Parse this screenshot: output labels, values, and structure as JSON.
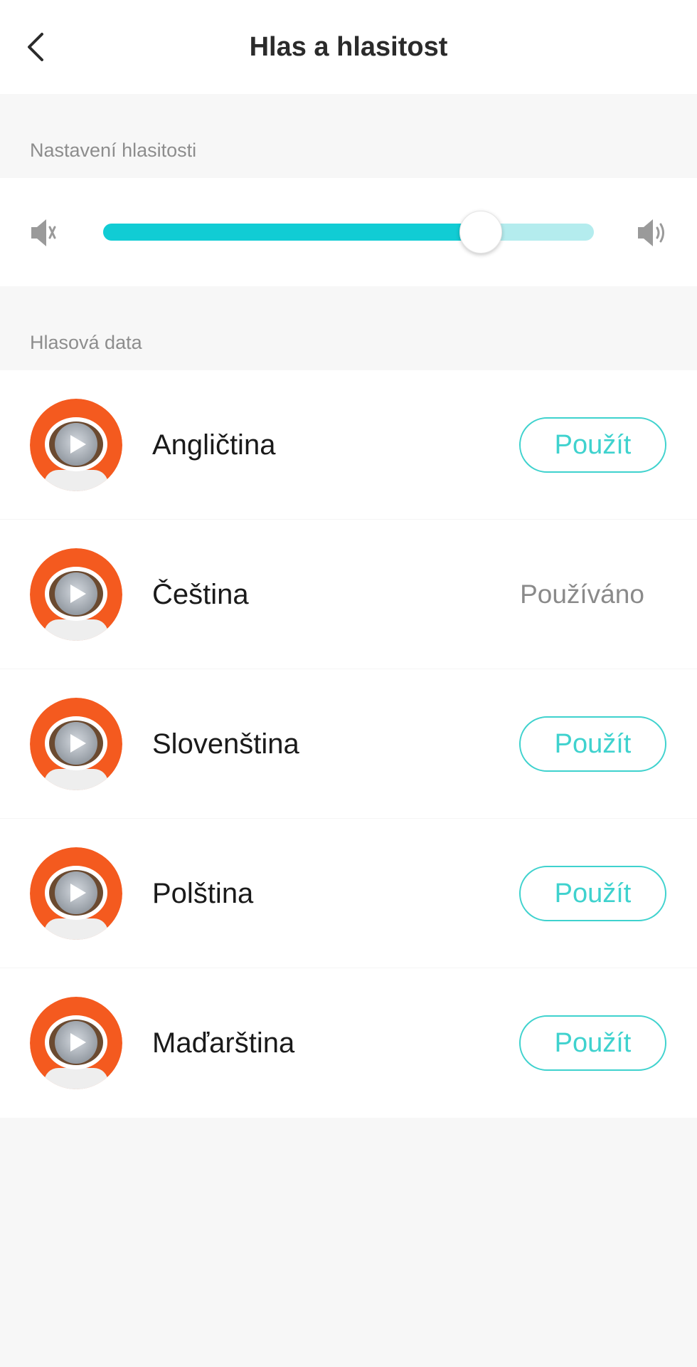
{
  "header": {
    "title": "Hlas a hlasitost",
    "back_icon": "chevron-left-icon"
  },
  "volume": {
    "section_label": "Nastavení hlasitosti",
    "mute_icon": "speaker-mute-icon",
    "loud_icon": "speaker-loud-icon",
    "level": 0.77,
    "colors": {
      "fill": "#11ccd4",
      "track": "#b4ecee"
    }
  },
  "voices": {
    "section_label": "Hlasová data",
    "play_icon": "play-icon",
    "items": [
      {
        "name": "Angličtina",
        "action": "Použít",
        "in_use": false
      },
      {
        "name": "Čeština",
        "action": "Používáno",
        "in_use": true
      },
      {
        "name": "Slovenština",
        "action": "Použít",
        "in_use": false
      },
      {
        "name": "Polština",
        "action": "Použít",
        "in_use": false
      },
      {
        "name": "Maďarština",
        "action": "Použít",
        "in_use": false
      }
    ]
  },
  "colors": {
    "accent": "#3fd2ce",
    "avatar_orange": "#f45a1f",
    "background": "#f7f7f7"
  }
}
